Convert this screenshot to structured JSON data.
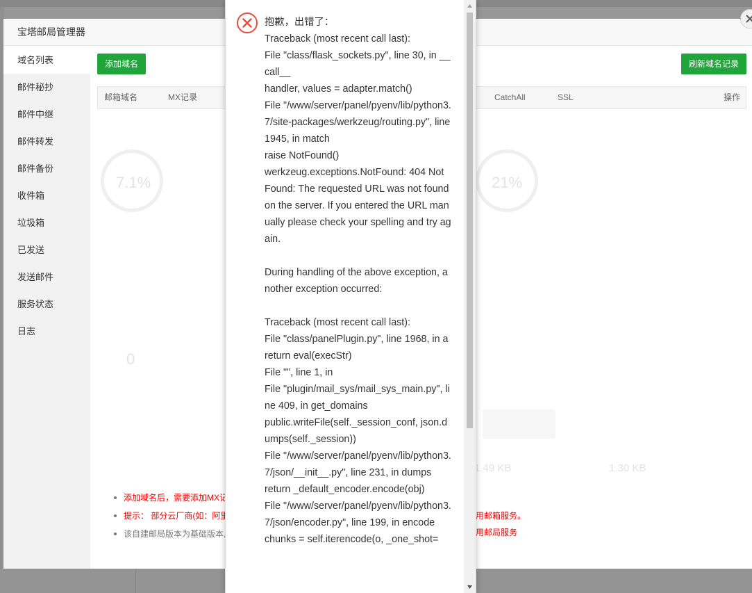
{
  "window": {
    "title": "宝塔邮局管理器"
  },
  "sidebar": {
    "items": [
      {
        "label": "域名列表",
        "active": true
      },
      {
        "label": "邮件秘抄"
      },
      {
        "label": "邮件中继"
      },
      {
        "label": "邮件转发"
      },
      {
        "label": "邮件备份"
      },
      {
        "label": "收件箱"
      },
      {
        "label": "垃圾箱"
      },
      {
        "label": "已发送"
      },
      {
        "label": "发送邮件"
      },
      {
        "label": "服务状态"
      },
      {
        "label": "日志"
      }
    ]
  },
  "toolbar": {
    "add_domain": "添加域名",
    "refresh_records": "刷新域名记录"
  },
  "table": {
    "columns": [
      "邮箱域名",
      "MX记录",
      "CatchAll",
      "SSL",
      "操作"
    ]
  },
  "notes": {
    "items": [
      {
        "left": "添加域名后，需要添加MX记",
        "right": "用邮箱服务。",
        "color": "red"
      },
      {
        "left": "提示： 部分云厂商(如：阿里",
        "right": "用邮局服务",
        "color": "red"
      },
      {
        "left": "该自建邮局版本为基础版本,",
        "right": "",
        "color": "gray"
      }
    ]
  },
  "ghost": {
    "pct_left": "7.1%",
    "pct_right": "21%",
    "zero": "0",
    "speed_left": "1.49 KB",
    "speed_right": "1.30 KB"
  },
  "error": {
    "title": "抱歉，出错了：",
    "text": "Traceback (most recent call last):\nFile \"class/flask_sockets.py\", line 30, in __call__\nhandler, values = adapter.match()\nFile \"/www/server/panel/pyenv/lib/python3.7/site-packages/werkzeug/routing.py\", line 1945, in match\nraise NotFound()\nwerkzeug.exceptions.NotFound: 404 Not Found: The requested URL was not found on the server. If you entered the URL manually please check your spelling and try again.\n\nDuring handling of the above exception, another exception occurred:\n\nTraceback (most recent call last):\nFile \"class/panelPlugin.py\", line 1968, in a\nreturn eval(execStr)\nFile \"\", line 1, in\nFile \"plugin/mail_sys/mail_sys_main.py\", line 409, in get_domains\npublic.writeFile(self._session_conf, json.dumps(self._session))\nFile \"/www/server/panel/pyenv/lib/python3.7/json/__init__.py\", line 231, in dumps\nreturn _default_encoder.encode(obj)\nFile \"/www/server/panel/pyenv/lib/python3.7/json/encoder.py\", line 199, in encode\nchunks = self.iterencode(o, _one_shot="
  },
  "colors": {
    "brand_green": "#20a53a",
    "error_red": "#e74c3c",
    "warning_text": "#ee0000"
  }
}
